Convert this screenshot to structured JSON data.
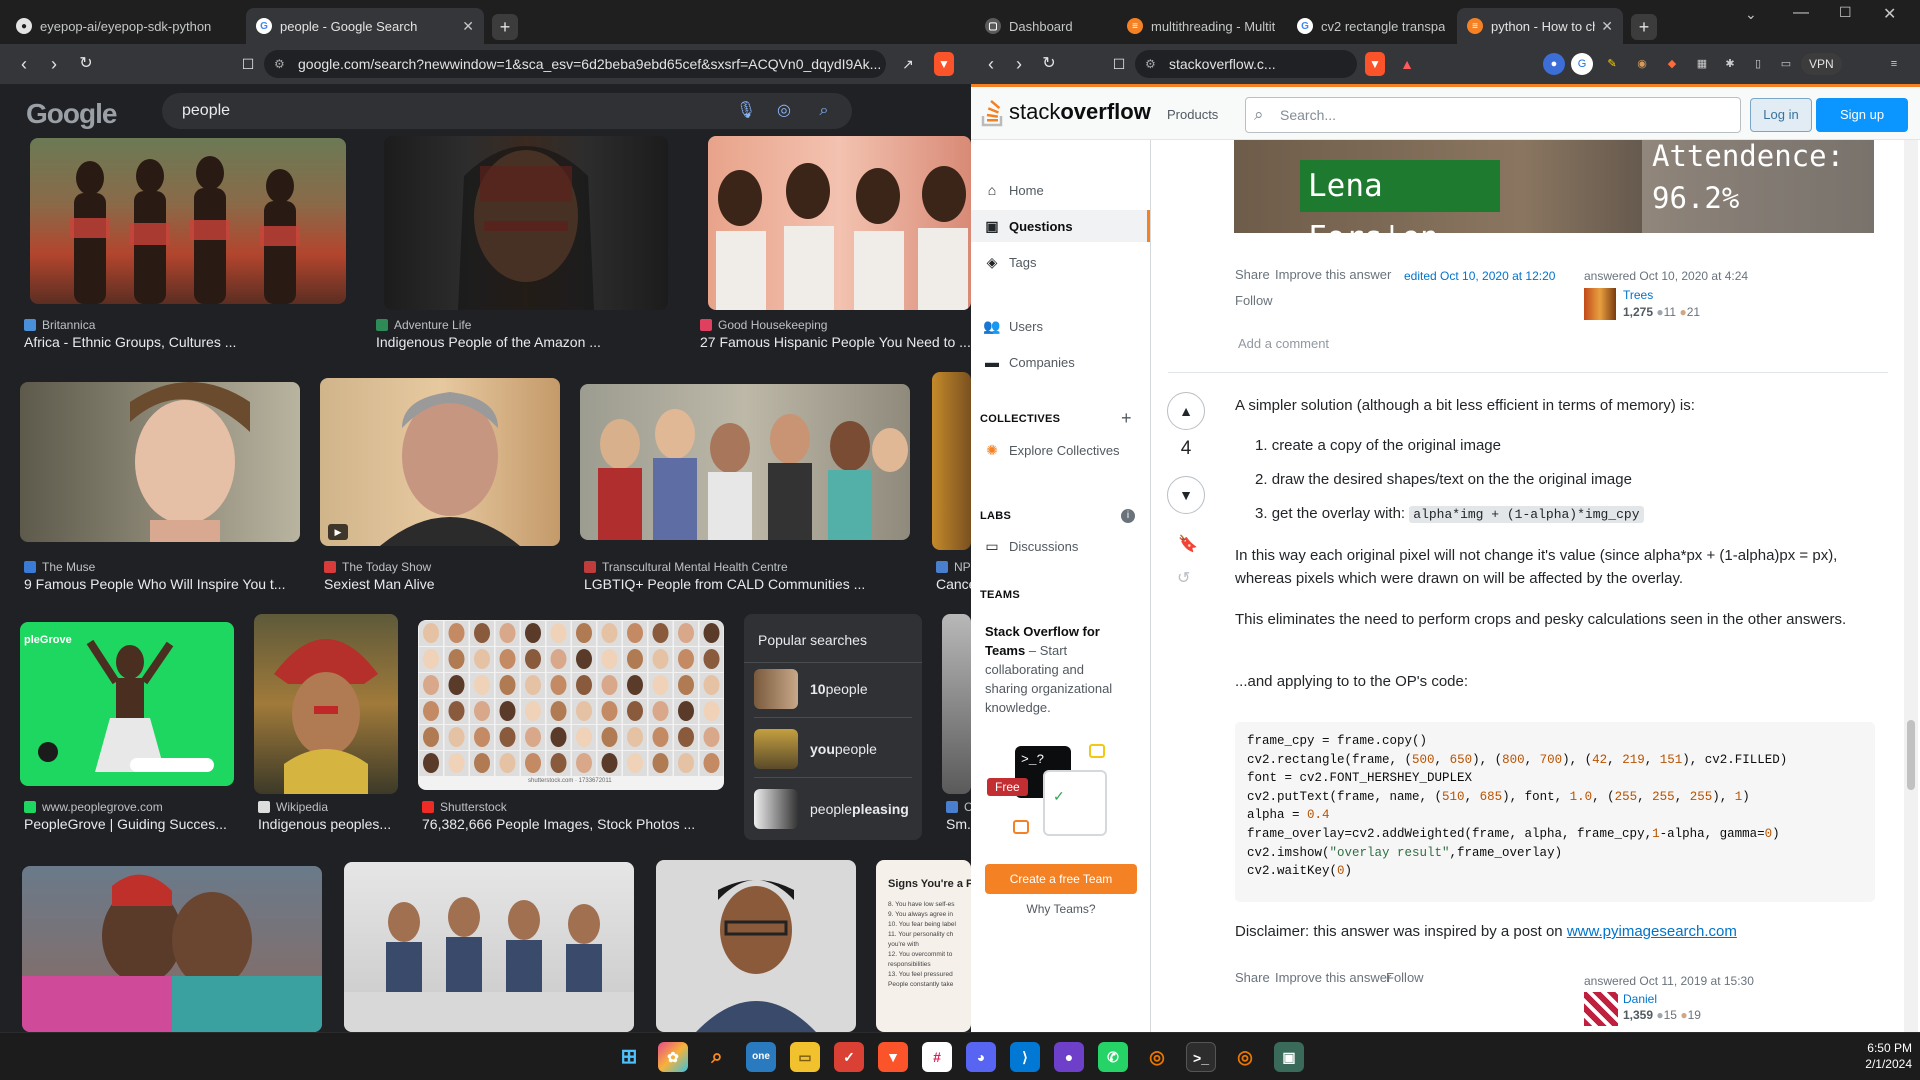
{
  "left_window": {
    "tabs": [
      {
        "title": "eyepop-ai/eyepop-sdk-python",
        "active": false
      },
      {
        "title": "people - Google Search",
        "active": true
      }
    ],
    "url": "google.com/search?newwindow=1&sca_esv=6d2beba9ebd65cef&sxsrf=ACQVn0_dqydI9Ak...",
    "google": {
      "logo": "Google",
      "query": "people",
      "results": [
        {
          "source": "Britannica",
          "title": "Africa - Ethnic Groups, Cultures ..."
        },
        {
          "source": "Adventure Life",
          "title": "Indigenous People of the Amazon ..."
        },
        {
          "source": "Good Housekeeping",
          "title": "27 Famous Hispanic People You Need to ..."
        },
        {
          "source": "The Muse",
          "title": "9 Famous People Who Will Inspire You t..."
        },
        {
          "source": "The Today Show",
          "title": "Sexiest Man Alive"
        },
        {
          "source": "Transcultural Mental Health Centre",
          "title": "LGBTIQ+ People from CALD Communities ..."
        },
        {
          "source": "NPR",
          "title": "Cance..."
        },
        {
          "source": "www.peoplegrove.com",
          "title": "PeopleGrove | Guiding Succes..."
        },
        {
          "source": "Wikipedia",
          "title": "Indigenous peoples..."
        },
        {
          "source": "Shutterstock",
          "title": "76,382,666 People Images, Stock Photos ..."
        },
        {
          "source": "C",
          "title": "Sm..."
        }
      ],
      "popular_searches": {
        "heading": "Popular searches",
        "items": [
          {
            "bold": "10",
            "rest": " people"
          },
          {
            "bold": "you",
            "rest": " people"
          },
          {
            "bold": "",
            "rest": "people ",
            "bold_after": "pleasing"
          }
        ]
      },
      "thumb_texts": {
        "peoplegrove": "pleGrove",
        "shutterstock": "shutterstock.com · 1733672011",
        "signs": "Signs You're a P",
        "signs_lines": [
          "8. You have low self-es",
          "9. You always agree in",
          "10. You fear being label",
          "11. Your personality ch",
          "you're with",
          "12. You overcommit to",
          "responsibilities",
          "13. You feel pressured",
          "People constantly take"
        ]
      }
    }
  },
  "right_window": {
    "tabs": [
      {
        "title": "Dashboard",
        "active": false
      },
      {
        "title": "multithreading - Multith",
        "active": false
      },
      {
        "title": "cv2 rectangle transparen",
        "active": false
      },
      {
        "title": "python - How to cha",
        "active": true
      }
    ],
    "url": "stackoverflow.c...",
    "vpn_label": "VPN",
    "header": {
      "logo_plain": "stack",
      "logo_bold": "overflow",
      "products": "Products",
      "search_placeholder": "Search...",
      "login": "Log in",
      "signup": "Sign up"
    },
    "sidebar": {
      "items": [
        "Home",
        "Questions",
        "Tags",
        "Users",
        "Companies"
      ],
      "collectives_heading": "COLLECTIVES",
      "explore_collectives": "Explore Collectives",
      "labs_heading": "LABS",
      "discussions": "Discussions",
      "teams_heading": "TEAMS",
      "teams_title": "Stack Overflow for Teams",
      "teams_text": " – Start collaborating and sharing organizational knowledge.",
      "free_badge": "Free",
      "create_team": "Create a free Team",
      "why_teams": "Why Teams?"
    },
    "answer1": {
      "banner_name": "Lena Fors'en",
      "banner_stat1": "Attendence:",
      "banner_stat2": "96.2%",
      "share": "Share",
      "improve": "Improve this answer",
      "follow": "Follow",
      "edited": "edited Oct 10, 2020 at 12:20",
      "answered": "answered Oct 10, 2020 at 4:24",
      "user": "Trees",
      "rep": "1,275",
      "silver": "11",
      "bronze": "21",
      "add_comment": "Add a comment"
    },
    "answer2": {
      "votes": "4",
      "intro": "A simpler solution (although a bit less efficient in terms of memory) is:",
      "steps": [
        "create a copy of the original image",
        "draw the desired shapes/text on the the original image",
        "get the overlay with: "
      ],
      "step3_code": "alpha*img + (1-alpha)*img_cpy",
      "para1": "In this way each original pixel will not change it's value (since alpha*px + (1-alpha)px = px), whereas pixels which were drawn on will be affected by the overlay.",
      "para2": "This eliminates the need to perform crops and pesky calculations seen in the other answers.",
      "para3": "...and applying to to the OP's code:",
      "code_lines": [
        "frame_cpy = frame.copy()",
        "cv2.rectangle(frame, (500, 650), (800, 700), (42, 219, 151), cv2.FILLED)",
        "font = cv2.FONT_HERSHEY_DUPLEX",
        "cv2.putText(frame, name, (510, 685), font, 1.0, (255, 255, 255), 1)",
        "alpha = 0.4",
        "frame_overlay=cv2.addWeighted(frame, alpha, frame_cpy,1-alpha, gamma=0)",
        "cv2.imshow(\"overlay result\",frame_overlay)",
        "cv2.waitKey(0)"
      ],
      "disclaimer": "Disclaimer: this answer was inspired by a post on ",
      "disclaimer_link": "www.pyimagesearch.com",
      "share": "Share",
      "improve": "Improve this answer",
      "follow": "Follow",
      "answered": "answered Oct 11, 2019 at 15:30",
      "user": "Daniel",
      "rep": "1,359",
      "silver": "15",
      "bronze": "19"
    }
  },
  "taskbar": {
    "time": "6:50 PM",
    "date": "2/1/2024"
  },
  "colors": {
    "so_orange": "#f48225",
    "so_blue": "#0a95ff",
    "google_bg": "#202124"
  }
}
